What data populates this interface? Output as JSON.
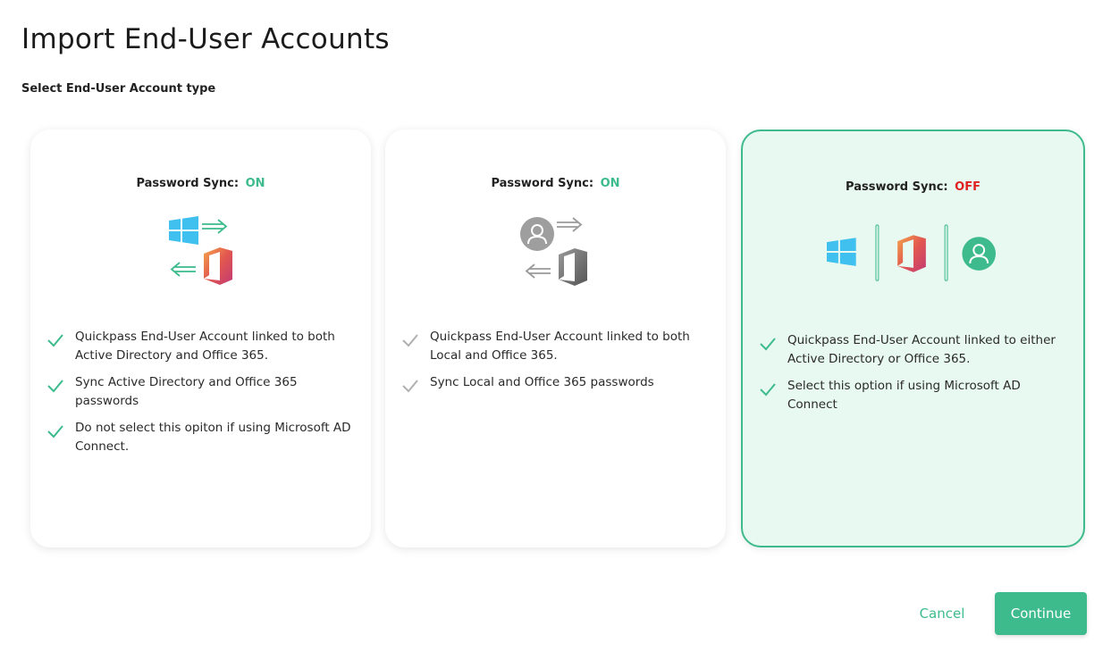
{
  "page": {
    "title": "Import End-User Accounts",
    "subtitle": "Select End-User Account type"
  },
  "colors": {
    "accent": "#3dbb8c",
    "off": "#e02020",
    "selected_bg": "#e8f9f1"
  },
  "cards": [
    {
      "sync_label": "Password Sync:",
      "sync_state": "ON",
      "selected": false,
      "icons": [
        "windows-icon",
        "office-icon",
        "arrow-right-icon",
        "arrow-left-icon"
      ],
      "features": [
        "Quickpass End-User Account linked to both Active Directory and Office 365.",
        "Sync Active Directory and Office 365 passwords",
        "Do not select this opiton if using Microsoft AD Connect."
      ]
    },
    {
      "sync_label": "Password Sync:",
      "sync_state": "ON",
      "selected": false,
      "icons": [
        "user-icon",
        "office-icon",
        "arrow-right-icon",
        "arrow-left-icon"
      ],
      "features": [
        "Quickpass End-User Account linked to both Local and Office 365.",
        "Sync Local and Office 365 passwords"
      ]
    },
    {
      "sync_label": "Password Sync:",
      "sync_state": "OFF",
      "selected": true,
      "icons": [
        "windows-icon",
        "office-icon",
        "user-icon"
      ],
      "features": [
        "Quickpass End-User Account linked to either Active Directory or Office 365.",
        "Select this option if using Microsoft AD Connect"
      ]
    }
  ],
  "actions": {
    "cancel_label": "Cancel",
    "continue_label": "Continue"
  }
}
